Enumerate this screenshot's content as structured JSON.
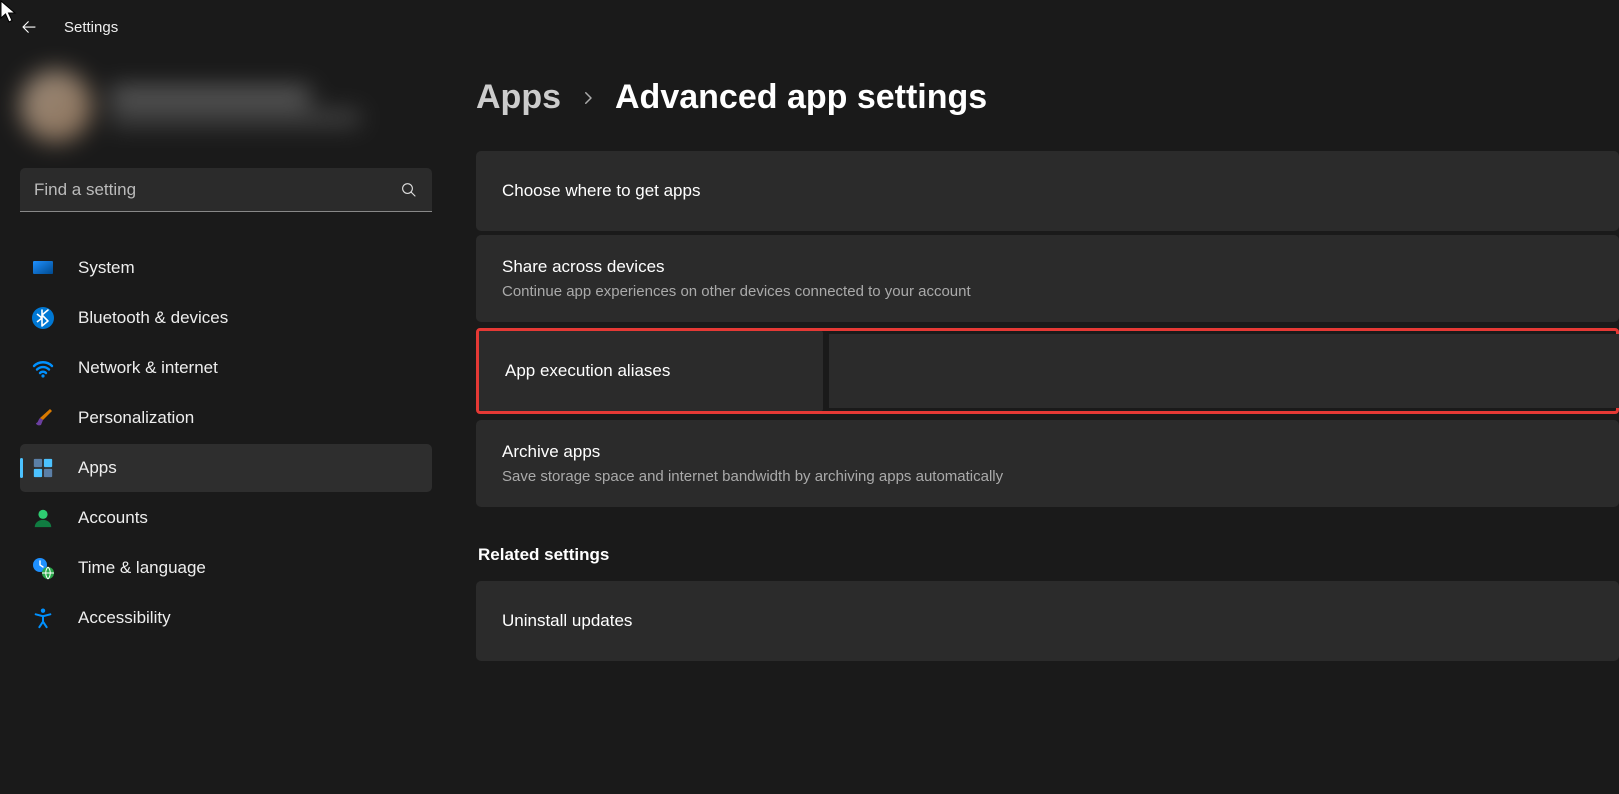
{
  "app_title": "Settings",
  "search": {
    "placeholder": "Find a setting"
  },
  "sidebar": {
    "items": [
      {
        "label": "System",
        "icon": "monitor"
      },
      {
        "label": "Bluetooth & devices",
        "icon": "bluetooth"
      },
      {
        "label": "Network & internet",
        "icon": "wifi"
      },
      {
        "label": "Personalization",
        "icon": "brush"
      },
      {
        "label": "Apps",
        "icon": "apps",
        "active": true
      },
      {
        "label": "Accounts",
        "icon": "person"
      },
      {
        "label": "Time & language",
        "icon": "clock-globe"
      },
      {
        "label": "Accessibility",
        "icon": "accessibility"
      }
    ]
  },
  "breadcrumb": {
    "parent": "Apps",
    "current": "Advanced app settings"
  },
  "cards": [
    {
      "title": "Choose where to get apps"
    },
    {
      "title": "Share across devices",
      "sub": "Continue app experiences on other devices connected to your account"
    },
    {
      "title": "App execution aliases",
      "highlight": true
    },
    {
      "title": "Archive apps",
      "sub": "Save storage space and internet bandwidth by archiving apps automatically"
    }
  ],
  "related": {
    "label": "Related settings",
    "items": [
      {
        "title": "Uninstall updates"
      }
    ]
  }
}
